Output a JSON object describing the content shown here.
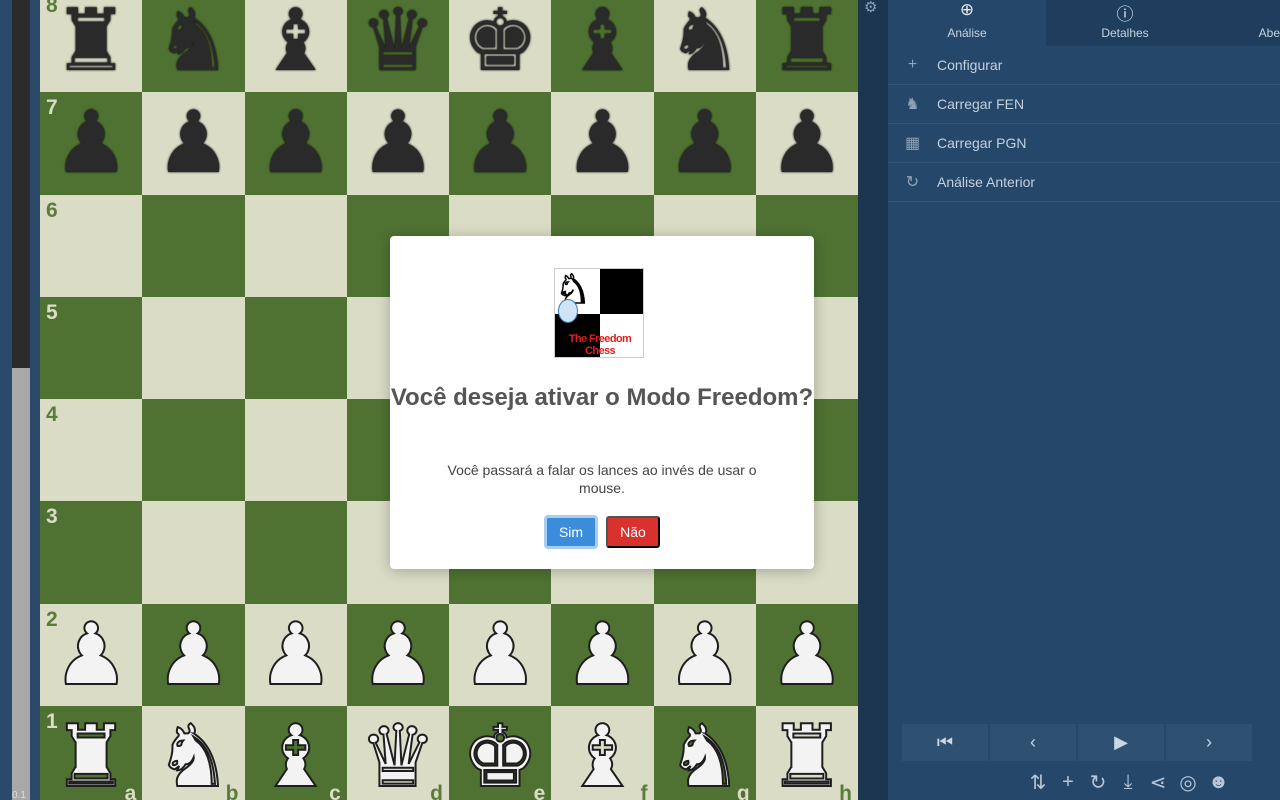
{
  "eval_bar": {
    "text": "0.1",
    "white_share": 0.54
  },
  "board": {
    "ranks": [
      "8",
      "7",
      "6",
      "5",
      "4",
      "3",
      "2",
      "1"
    ],
    "files": [
      "a",
      "b",
      "c",
      "d",
      "e",
      "f",
      "g",
      "h"
    ],
    "rows": [
      [
        "bR",
        "bN",
        "bB",
        "bQ",
        "bK",
        "bB",
        "bN",
        "bR"
      ],
      [
        "bP",
        "bP",
        "bP",
        "bP",
        "bP",
        "bP",
        "bP",
        "bP"
      ],
      [
        "",
        "",
        "",
        "",
        "",
        "",
        "",
        ""
      ],
      [
        "",
        "",
        "",
        "",
        "",
        "",
        "",
        ""
      ],
      [
        "",
        "",
        "",
        "",
        "",
        "",
        "",
        ""
      ],
      [
        "",
        "",
        "",
        "",
        "",
        "",
        "",
        ""
      ],
      [
        "wP",
        "wP",
        "wP",
        "wP",
        "wP",
        "wP",
        "wP",
        "wP"
      ],
      [
        "wR",
        "wN",
        "wB",
        "wQ",
        "wK",
        "wB",
        "wN",
        "wR"
      ]
    ],
    "colors": {
      "light": "#dadcc6",
      "dark": "#4f7232"
    }
  },
  "panel": {
    "tabs": [
      {
        "label": "Análise",
        "icon": "magnifier-plus-icon"
      },
      {
        "label": "Detalhes",
        "icon": "info-icon"
      },
      {
        "label": "Aber",
        "icon": ""
      }
    ],
    "menu": [
      {
        "label": "Configurar",
        "icon": "plus-icon",
        "glyph": "+"
      },
      {
        "label": "Carregar FEN",
        "icon": "chess-pieces-icon",
        "glyph": "♞"
      },
      {
        "label": "Carregar PGN",
        "icon": "checkerboard-icon",
        "glyph": "▦"
      },
      {
        "label": "Análise Anterior",
        "icon": "history-icon",
        "glyph": "↻"
      }
    ],
    "nav": [
      {
        "name": "first-move-button",
        "glyph": "⏮"
      },
      {
        "name": "previous-move-button",
        "glyph": "‹"
      },
      {
        "name": "play-button",
        "glyph": "▶"
      },
      {
        "name": "next-move-button",
        "glyph": "›"
      }
    ],
    "tools": [
      {
        "name": "flip-board-icon",
        "glyph": "⇅"
      },
      {
        "name": "add-icon",
        "glyph": "+"
      },
      {
        "name": "reload-icon",
        "glyph": "↻"
      },
      {
        "name": "download-icon",
        "glyph": "⤓"
      },
      {
        "name": "share-icon",
        "glyph": "⋖"
      },
      {
        "name": "target-icon",
        "glyph": "◎"
      },
      {
        "name": "user-chat-icon",
        "glyph": "☻"
      }
    ]
  },
  "modal": {
    "logo_text": "The Freedom Chess",
    "title": "Você deseja ativar o Modo Freedom?",
    "text": "Você passará a falar os lances ao invés de usar o mouse.",
    "yes_label": "Sim",
    "no_label": "Não",
    "yes_color": "#3b8ddc",
    "no_color": "#d9312e"
  }
}
